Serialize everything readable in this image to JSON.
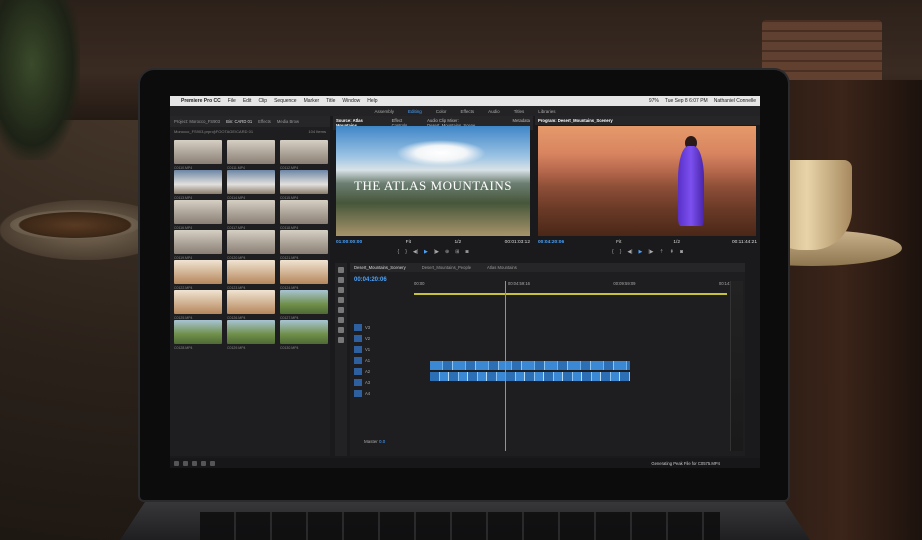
{
  "menubar": {
    "apple": "",
    "app_name": "Premiere Pro CC",
    "menus": [
      "File",
      "Edit",
      "Clip",
      "Sequence",
      "Marker",
      "Title",
      "Window",
      "Help"
    ],
    "battery": "97%",
    "clock": "Tue Sep 8 6:07 PM",
    "user": "Nathaniel Connelle"
  },
  "workspaces": [
    "Assembly",
    "Editing",
    "Color",
    "Effects",
    "Audio",
    "Titles",
    "Libraries"
  ],
  "workspace_active_index": 1,
  "project": {
    "tabs": [
      "Project: Morocco_FS903",
      "Bin: CARD 01",
      "Effects",
      "Media Brow"
    ],
    "path": "Morocco_FS903.prproj\\FOOTAGE\\CARD 01",
    "count": "104 Items",
    "clips": [
      {
        "name": "C0110.MP4",
        "dur": "2:14"
      },
      {
        "name": "C0111.MP4",
        "dur": "4:13"
      },
      {
        "name": "C0112.MP4",
        "dur": "2:07"
      },
      {
        "name": "C0113.MP4",
        "dur": "2:16"
      },
      {
        "name": "C0114.MP4",
        "dur": "2:30"
      },
      {
        "name": "C0115.MP4",
        "dur": "1:28"
      },
      {
        "name": "C0116.MP4",
        "dur": "0:13"
      },
      {
        "name": "C0117.MP4",
        "dur": "2:09"
      },
      {
        "name": "C0118.MP4",
        "dur": "1:16"
      },
      {
        "name": "C0119.MP4",
        "dur": "0:29"
      },
      {
        "name": "C0120.MP4",
        "dur": "2:09"
      },
      {
        "name": "C0121.MP4",
        "dur": "0:05"
      },
      {
        "name": "C0122.MP4",
        "dur": "2:01"
      },
      {
        "name": "C0123.MP4",
        "dur": "2:00"
      },
      {
        "name": "C0124.MP4",
        "dur": "0:18"
      },
      {
        "name": "C0125.MP4",
        "dur": "3:08"
      },
      {
        "name": "C0126.MP4",
        "dur": "0:02"
      },
      {
        "name": "C0127.MP4",
        "dur": "2:14"
      },
      {
        "name": "C0128.MP4",
        "dur": "4:01"
      },
      {
        "name": "C0129.MP4",
        "dur": "0:01"
      },
      {
        "name": "C0130.MP4",
        "dur": "1:40"
      }
    ]
  },
  "source": {
    "tabs": [
      "Source: Atlas Mountains",
      "Effect Controls",
      "Audio Clip Mixer: Desert_Mountains_Scene",
      "Metadata"
    ],
    "frame_title": "THE ATLAS MOUNTAINS",
    "timecode_in": "01:00:00:00",
    "fit": "Fit",
    "scale": "1/2",
    "timecode_out": "00:01:03:12"
  },
  "program": {
    "tabs": [
      "Program: Desert_Mountains_Scenery"
    ],
    "timecode_in": "00:04:20:06",
    "fit": "Fit",
    "scale": "1/2",
    "timecode_out": "00:11:44:21"
  },
  "timeline": {
    "tabs": [
      "Desert_Mountains_Scenery",
      "Desert_Mountains_People",
      "Atlas Mountains"
    ],
    "current_tc": "00:04:20:06",
    "ruler": [
      "00:00",
      "00:04:59:16",
      "00:09:59:09",
      "00:14:59:02"
    ],
    "tracks": [
      "V3",
      "V2",
      "V1",
      "A1",
      "A2",
      "A3",
      "A4"
    ],
    "master_label": "Master",
    "master_value": "0.0"
  },
  "status_text": "Generating Peak File for C0575.MP4"
}
